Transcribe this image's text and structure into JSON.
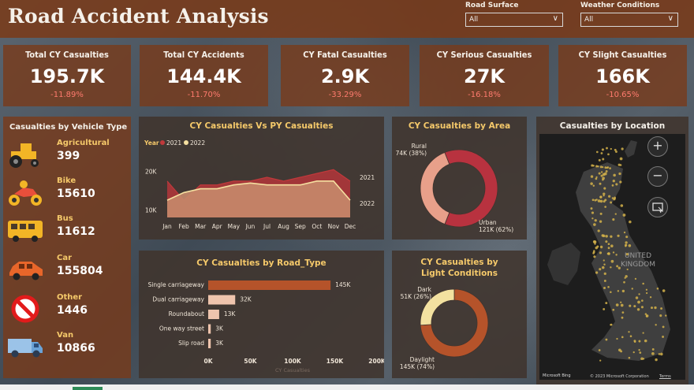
{
  "title": "Road Accident Analysis",
  "filters": [
    {
      "label": "Road Surface",
      "value": "All"
    },
    {
      "label": "Weather Conditions",
      "value": "All"
    }
  ],
  "kpis": [
    {
      "title": "Total CY Casualties",
      "value": "195.7K",
      "delta": "-11.89%"
    },
    {
      "title": "Total CY Accidents",
      "value": "144.4K",
      "delta": "-11.70%"
    },
    {
      "title": "CY Fatal Casualties",
      "value": "2.9K",
      "delta": "-33.29%"
    },
    {
      "title": "CY Serious Casualties",
      "value": "27K",
      "delta": "-16.18%"
    },
    {
      "title": "CY Slight Casualties",
      "value": "166K",
      "delta": "-10.65%"
    }
  ],
  "vehicle_panel": {
    "title": "Casualties by Vehicle Type",
    "items": [
      {
        "name": "Agricultural",
        "value": "399",
        "icon": "tractor-icon"
      },
      {
        "name": "Bike",
        "value": "15610",
        "icon": "motorbike-icon"
      },
      {
        "name": "Bus",
        "value": "11612",
        "icon": "bus-icon"
      },
      {
        "name": "Car",
        "value": "155804",
        "icon": "car-icon"
      },
      {
        "name": "Other",
        "value": "1446",
        "icon": "no-entry-icon"
      },
      {
        "name": "Van",
        "value": "10866",
        "icon": "van-icon"
      }
    ]
  },
  "map_panel": {
    "title": "Casualties by Location",
    "watermark": "UNITED KINGDOM",
    "attribution": "© 2023 Microsoft Corporation",
    "terms": "Terms",
    "bing": "Microsoft Bing"
  },
  "colors": {
    "accent": "#f5c96a",
    "panel": "#7a3a18",
    "line2021": "#c0393b",
    "line2022": "#f5dfa0",
    "bar": "#b5532a",
    "negative": "#ff7b6e"
  },
  "chart_data": [
    {
      "type": "area",
      "title": "CY Casualties Vs PY Casualties",
      "legend_title": "Year",
      "legend_position": "top-left",
      "categories": [
        "Jan",
        "Feb",
        "Mar",
        "Apr",
        "May",
        "Jun",
        "Jul",
        "Aug",
        "Sep",
        "Oct",
        "Nov",
        "Dec"
      ],
      "series": [
        {
          "name": "2021",
          "values": [
            17500,
            12500,
            16500,
            16500,
            17500,
            17500,
            18500,
            17500,
            18500,
            19500,
            20500,
            17500
          ]
        },
        {
          "name": "2022",
          "values": [
            12500,
            14500,
            15500,
            15500,
            16500,
            17000,
            16500,
            16500,
            16500,
            17500,
            17500,
            12500
          ]
        }
      ],
      "end_labels": [
        "2021",
        "2022"
      ],
      "yticks": [
        "20K",
        "10K"
      ],
      "ytick_values": [
        20000,
        10000
      ],
      "ylim": [
        8000,
        22000
      ]
    },
    {
      "type": "pie",
      "title": "CY Casualties by Area",
      "slices": [
        {
          "label": "Urban",
          "value": 121,
          "display": "121K (62%)",
          "color": "#b8323f"
        },
        {
          "label": "Rural",
          "value": 74,
          "display": "74K (38%)",
          "color": "#e8a08a"
        }
      ]
    },
    {
      "type": "bar",
      "orientation": "horizontal",
      "title": "CY Casualties by Road_Type",
      "categories": [
        "Single carriageway",
        "Dual carriageway",
        "Roundabout",
        "One way street",
        "Slip road"
      ],
      "values": [
        145000,
        32000,
        13000,
        3000,
        3000
      ],
      "data_labels": [
        "145K",
        "32K",
        "13K",
        "3K",
        "3K"
      ],
      "xticks": [
        "0K",
        "50K",
        "100K",
        "150K",
        "200K"
      ],
      "xtick_values": [
        0,
        50000,
        100000,
        150000,
        200000
      ],
      "xlabel": "CY Casualties",
      "xlim": [
        0,
        200000
      ]
    },
    {
      "type": "pie",
      "title": "CY Casualties by Light Conditions",
      "slices": [
        {
          "label": "Daylight",
          "value": 145,
          "display": "145K (74%)",
          "color": "#b5532a"
        },
        {
          "label": "Dark",
          "value": 51,
          "display": "51K (26%)",
          "color": "#f3e1a0"
        }
      ]
    }
  ]
}
